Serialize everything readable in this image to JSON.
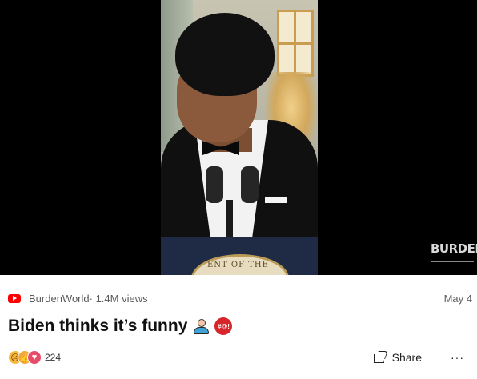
{
  "video": {
    "watermark": "BURDEN",
    "seal_text": "ENT OF THE"
  },
  "post": {
    "source_icon": "youtube-icon",
    "channel": "BurdenWorld",
    "views": "· 1.4M views",
    "date": "May 4",
    "title": "Biden thinks it’s funny",
    "title_emojis": [
      "person-at-computer-icon",
      "angry-face-icon"
    ],
    "angry_face_text": "#@!"
  },
  "reactions": {
    "icons": [
      "sad-reaction-icon",
      "like-reaction-icon",
      "love-reaction-icon"
    ],
    "count": "224"
  },
  "actions": {
    "share_label": "Share",
    "more_label": "···"
  },
  "colors": {
    "youtube_red": "#ff0000",
    "meta_gray": "#5a5a5a",
    "title_text": "#111111"
  }
}
